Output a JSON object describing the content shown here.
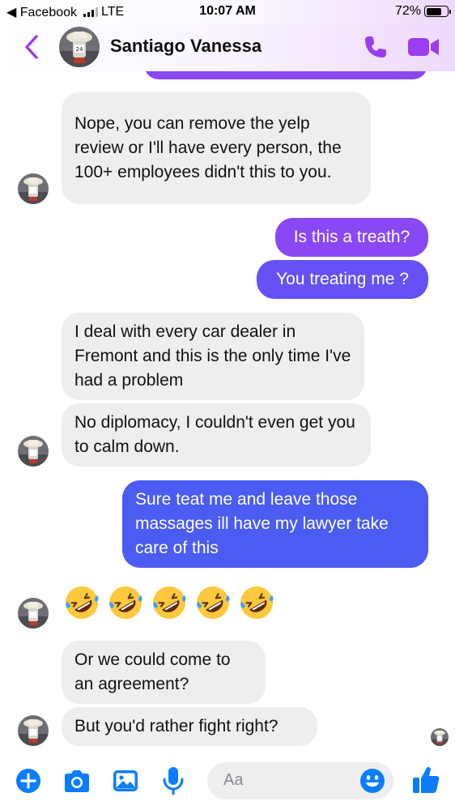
{
  "status_bar": {
    "back_app": "◀ Facebook",
    "network": "LTE",
    "time": "10:07 AM",
    "battery": "72%",
    "battery_level": 0.72
  },
  "header": {
    "contact_name": "Santiago Vanessa",
    "back_icon": "chevron-left-icon",
    "call_icon": "phone-icon",
    "video_icon": "video-camera-icon",
    "accent_color": "#9b3df0"
  },
  "messages": [
    {
      "from": "contact",
      "text": "Nope, you can remove the yelp review or I'll have every person, the 100+ employees didn't this to you."
    },
    {
      "from": "me",
      "text": "Is this a treath?"
    },
    {
      "from": "me",
      "text": "You treating me ?"
    },
    {
      "from": "contact",
      "text": "I deal with every car dealer in Fremont and this is the only time I've had a problem"
    },
    {
      "from": "contact",
      "text": "No diplomacy, I couldn't even get you to calm down."
    },
    {
      "from": "me",
      "text": "Sure teat me and leave those massages ill have my lawyer take care of this"
    },
    {
      "from": "contact",
      "text": "🤣🤣🤣🤣🤣",
      "emoji_name": "rolling-on-the-floor-laughing",
      "count": 5
    },
    {
      "from": "contact",
      "text": "Or we could come to an agreement?"
    },
    {
      "from": "contact",
      "text": "But you'd rather fight right?"
    }
  ],
  "composer": {
    "placeholder": "Aa",
    "icons": [
      "plus-icon",
      "camera-icon",
      "image-icon",
      "microphone-icon",
      "emoji-icon",
      "thumbs-up-icon"
    ],
    "accent_color": "#0a7cff"
  },
  "colors": {
    "outgoing_purple": "#8a47f4",
    "outgoing_indigo": "#6551f5",
    "outgoing_blue": "#4a5cf2",
    "incoming_bg": "#eeeeef"
  }
}
